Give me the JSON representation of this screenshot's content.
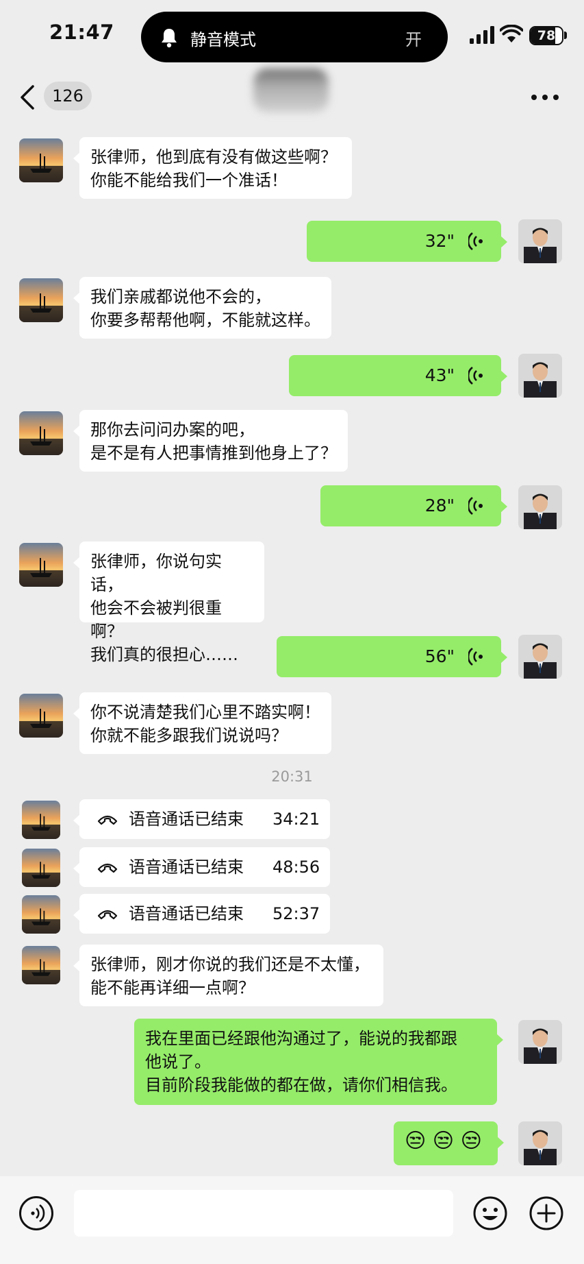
{
  "status_bar": {
    "time": "21:47",
    "island_label": "静音模式",
    "island_state": "开",
    "battery": "78"
  },
  "nav": {
    "back_count": "126"
  },
  "messages": [
    {
      "side": "left",
      "type": "text",
      "text": "张律师，他到底有没有做这些啊？\n你能不能给我们一个准话！"
    },
    {
      "side": "right",
      "type": "voice",
      "duration": "32\""
    },
    {
      "side": "left",
      "type": "text",
      "text": "我们亲戚都说他不会的，\n你要多帮帮他啊，不能就这样。"
    },
    {
      "side": "right",
      "type": "voice",
      "duration": "43\""
    },
    {
      "side": "left",
      "type": "text",
      "text": "那你去问问办案的吧，\n是不是有人把事情推到他身上了？"
    },
    {
      "side": "right",
      "type": "voice",
      "duration": "28\""
    },
    {
      "side": "left",
      "type": "text",
      "text": "张律师，你说句实话，\n他会不会被判很重啊？\n我们真的很担心……"
    },
    {
      "side": "right",
      "type": "voice",
      "duration": "56\""
    },
    {
      "side": "left",
      "type": "text",
      "text": "你不说清楚我们心里不踏实啊！\n你就不能多跟我们说说吗？"
    },
    {
      "side": "center",
      "type": "time",
      "text": "20:31"
    },
    {
      "side": "left",
      "type": "call",
      "label": "语音通话已结束",
      "duration": "34:21"
    },
    {
      "side": "left",
      "type": "call",
      "label": "语音通话已结束",
      "duration": "48:56"
    },
    {
      "side": "left",
      "type": "call",
      "label": "语音通话已结束",
      "duration": "52:37"
    },
    {
      "side": "left",
      "type": "text",
      "text": "张律师，刚才你说的我们还是不太懂，\n能不能再详细一点啊？"
    },
    {
      "side": "right",
      "type": "text",
      "text": "我在里面已经跟他沟通过了，能说的我都跟\n他说了。\n目前阶段我能做的都在做，请你们相信我。"
    },
    {
      "side": "right",
      "type": "text",
      "text": "😒 😒 😒"
    }
  ],
  "colors": {
    "sent_bubble": "#95ec69",
    "received_bubble": "#ffffff",
    "background": "#ededed"
  },
  "icons": [
    "bell-icon",
    "signal-icon",
    "wifi-icon",
    "battery-icon",
    "back-chevron-icon",
    "more-icon",
    "voice-wave-icon",
    "phone-hangup-icon",
    "voice-input-icon",
    "emoji-icon",
    "plus-icon"
  ]
}
